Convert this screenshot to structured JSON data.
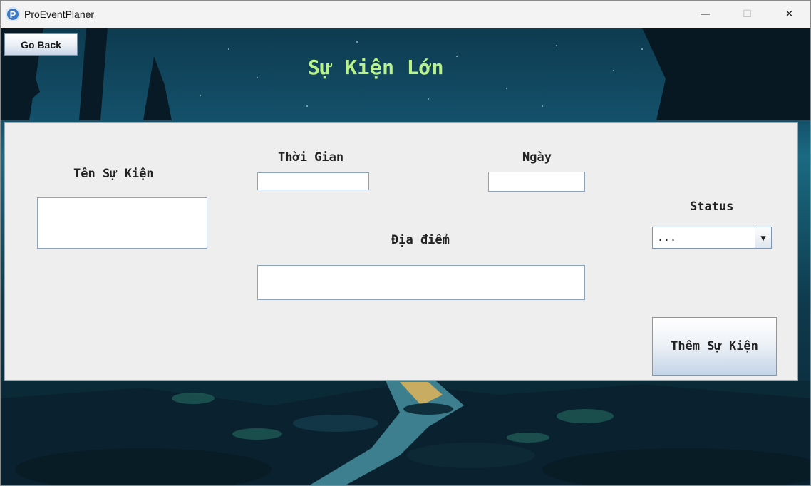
{
  "window": {
    "title": "ProEventPlaner",
    "app_icon_letter": "P",
    "controls": {
      "minimize": "—",
      "maximize": "☐",
      "close": "✕"
    }
  },
  "nav": {
    "go_back_label": "Go Back"
  },
  "page": {
    "title": "Sự Kiện Lớn"
  },
  "form": {
    "name_label": "Tên Sự Kiện",
    "name_value": "",
    "time_label": "Thời Gian",
    "time_value": "",
    "date_label": "Ngày",
    "date_value": "",
    "location_label": "Địa điểm",
    "location_value": "",
    "status_label": "Status",
    "status_selected": "...",
    "status_arrow": "▼",
    "submit_label": "Thêm Sự Kiện"
  },
  "colors": {
    "title_text": "#b9f28a",
    "panel_bg": "#eeeeee",
    "sky": "#14506a"
  },
  "icons": [
    "app-logo-icon",
    "minimize-icon",
    "maximize-icon",
    "close-icon",
    "dropdown-arrow-icon"
  ]
}
